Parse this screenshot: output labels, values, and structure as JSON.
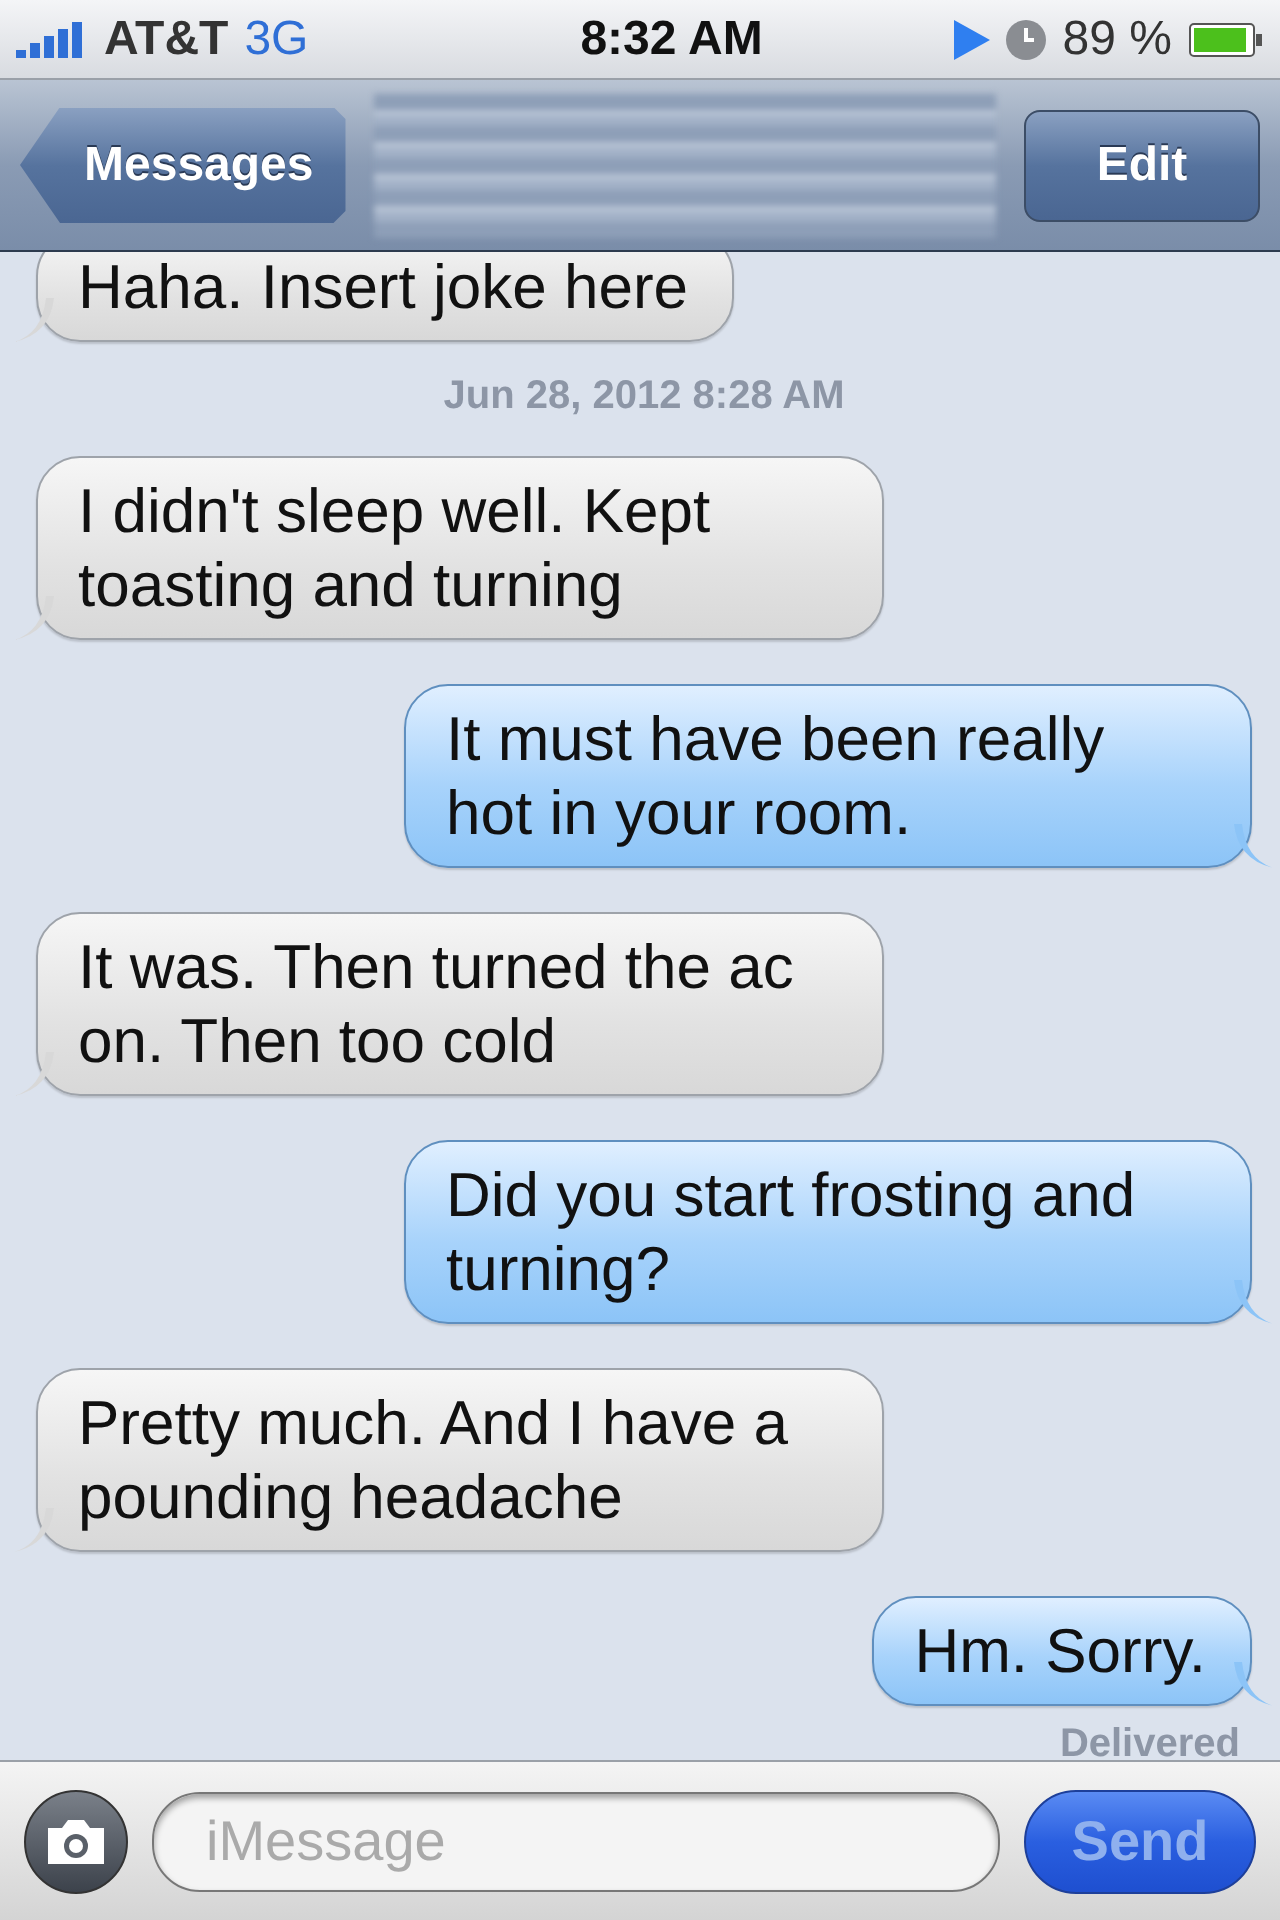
{
  "status_bar": {
    "carrier": "AT&T",
    "network": "3G",
    "time": "8:32 AM",
    "battery": "89 %"
  },
  "nav_bar": {
    "back": "Messages",
    "title_redacted": true,
    "edit": "Edit"
  },
  "messages": [
    {
      "kind": "received",
      "text": "Haha. Insert joke here"
    },
    {
      "kind": "timestamp",
      "text": "Jun 28, 2012 8:28 AM"
    },
    {
      "kind": "received",
      "text": "I didn't sleep well. Kept toasting and turning"
    },
    {
      "kind": "sent",
      "text": "It must have been really hot in your room."
    },
    {
      "kind": "received",
      "text": "It was. Then turned the ac on. Then too cold"
    },
    {
      "kind": "sent",
      "text": "Did you start frosting and turning?"
    },
    {
      "kind": "received",
      "text": "Pretty much. And I have a pounding headache"
    },
    {
      "kind": "sent",
      "text": "Hm. Sorry."
    },
    {
      "kind": "status",
      "text": "Delivered"
    }
  ],
  "compose": {
    "placeholder": "iMessage",
    "send": "Send",
    "send_disabled": true
  }
}
